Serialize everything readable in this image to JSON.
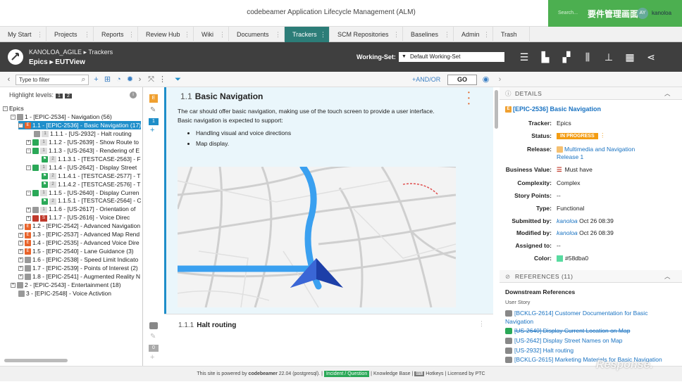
{
  "app": {
    "title": "codebeamer Application Lifecycle Management (ALM)",
    "jp_caption": "要件管理画面",
    "search_placeholder": "Search...",
    "avatar": "AY",
    "user": "kanoloa"
  },
  "nav": [
    "My Start",
    "Projects",
    "Reports",
    "Review Hub",
    "Wiki",
    "Documents",
    "Trackers",
    "SCM Repositories",
    "Baselines",
    "Admin",
    "Trash"
  ],
  "header": {
    "project": "KANOLOA_AGILE",
    "trackers": "Trackers",
    "tracker": "Epics",
    "view": "EUTView",
    "ws_label": "Working-Set:",
    "ws_value": "Default Working-Set"
  },
  "toolbar": {
    "filter_placeholder": "Type to filter",
    "andor": "AND/OR",
    "go": "GO"
  },
  "tree": {
    "highlight": "Highlight levels:",
    "lvl1": "1",
    "lvl2": "2",
    "nodes": [
      {
        "text": "Epics",
        "d": 0,
        "exp": "−",
        "ic": "none"
      },
      {
        "text": "1 - [EPIC-2534] - Navigation (56)",
        "d": 1,
        "exp": "−",
        "ic": "g"
      },
      {
        "text": "1.1 - [EPIC-2536] - Basic Navigation (17)",
        "d": 2,
        "exp": "−",
        "ic": "o",
        "sel": true
      },
      {
        "text": "1.1.1 - [US-2932] - Halt routing",
        "d": 3,
        "exp": "",
        "ic": "g",
        "lv": "1"
      },
      {
        "text": "1.1.2 - [US-2639] - Show Route to",
        "d": 3,
        "exp": "+",
        "ic": "c",
        "lv": "1"
      },
      {
        "text": "1.1.3 - [US-2643] - Rendering of E",
        "d": 3,
        "exp": "−",
        "ic": "c",
        "lv": "1"
      },
      {
        "text": "1.1.3.1 - [TESTCASE-2563] - F",
        "d": 4,
        "exp": "",
        "ic": "t",
        "lv": "2"
      },
      {
        "text": "1.1.4 - [US-2642] - Display Street",
        "d": 3,
        "exp": "−",
        "ic": "c",
        "lv": "1"
      },
      {
        "text": "1.1.4.1 - [TESTCASE-2577] - T",
        "d": 4,
        "exp": "",
        "ic": "t",
        "lv": "2"
      },
      {
        "text": "1.1.4.2 - [TESTCASE-2576] - T",
        "d": 4,
        "exp": "",
        "ic": "t",
        "lv": "2"
      },
      {
        "text": "1.1.5 - [US-2640] - Display Curren",
        "d": 3,
        "exp": "−",
        "ic": "c",
        "lv": "1"
      },
      {
        "text": "1.1.5.1 - [TESTCASE-2564] - C",
        "d": 4,
        "exp": "",
        "ic": "t",
        "lv": "2"
      },
      {
        "text": "1.1.6 - [US-2617] - Orientation of",
        "d": 3,
        "exp": "+",
        "ic": "g",
        "lv": "1"
      },
      {
        "text": "1.1.7 - [US-2616] - Voice Direc",
        "d": 3,
        "exp": "+",
        "ic": "r",
        "lv": "S"
      },
      {
        "text": "1.2 - [EPIC-2542] - Advanced Navigation",
        "d": 2,
        "exp": "+",
        "ic": "o"
      },
      {
        "text": "1.3 - [EPIC-2537] - Advanced Map Rend",
        "d": 2,
        "exp": "+",
        "ic": "o"
      },
      {
        "text": "1.4 - [EPIC-2535] - Advanced Voice Dire",
        "d": 2,
        "exp": "+",
        "ic": "o"
      },
      {
        "text": "1.5 - [EPIC-2540] - Lane Guidance (3)",
        "d": 2,
        "exp": "+",
        "ic": "o"
      },
      {
        "text": "1.6 - [EPIC-2538] - Speed Limit Indicato",
        "d": 2,
        "exp": "+",
        "ic": "g"
      },
      {
        "text": "1.7 - [EPIC-2539] - Points of Interest (2)",
        "d": 2,
        "exp": "+",
        "ic": "g"
      },
      {
        "text": "1.8 - [EPIC-2541] - Augmented Reality N",
        "d": 2,
        "exp": "+",
        "ic": "g"
      },
      {
        "text": "2 - [EPIC-2543] - Entertainment (18)",
        "d": 1,
        "exp": "+",
        "ic": "g"
      },
      {
        "text": "3 - [EPIC-2548] - Voice Activtion",
        "d": 1,
        "exp": "",
        "ic": "g"
      }
    ]
  },
  "doc": {
    "num": "1.1",
    "title": "Basic Navigation",
    "desc1": "The car should offer basic navigation, making use of the touch screen to provide a user interface.",
    "desc2": "Basic navigation is expected to support:",
    "bullets": [
      "Handling visual and voice directions",
      "Map display."
    ],
    "sub_num": "1.1.1",
    "sub_title": "Halt routing",
    "gut_num1": "1",
    "gut_num2": "0"
  },
  "details": {
    "head": "DETAILS",
    "item": "[EPIC-2536] Basic Navigation",
    "rows": [
      {
        "k": "Tracker:",
        "v": "Epics"
      },
      {
        "k": "Status:",
        "v": "IN PROGRESS"
      },
      {
        "k": "Release:",
        "v": "Multimedia and Navigation Release 1"
      },
      {
        "k": "Business Value:",
        "v": "Must have"
      },
      {
        "k": "Complexity:",
        "v": "Complex"
      },
      {
        "k": "Story Points:",
        "v": "--"
      },
      {
        "k": "Type:",
        "v": "Functional"
      },
      {
        "k": "Submitted by:",
        "v": "kanoloa",
        "d": "Oct 26 08:39"
      },
      {
        "k": "Modified by:",
        "v": "kanoloa",
        "d": "Oct 26 08:39"
      },
      {
        "k": "Assigned to:",
        "v": "--"
      },
      {
        "k": "Color:",
        "v": "#58dba0"
      }
    ]
  },
  "references": {
    "head": "REFERENCES (11)",
    "downstream": "Downstream References",
    "type": "User Story",
    "items": [
      "[BCKLG-2614] Customer Documentation for Basic Navigation",
      "[US-2640] Display Current Location on Map",
      "[US-2642] Display Street Names on Map",
      "[US-2932] Halt routing",
      "[BCKLG-2615] Marketing Materials for Basic Navigation"
    ]
  },
  "footer": {
    "pre": "This site is powered by",
    "brand": "codebeamer",
    "ver": "22.04 (postgresql).",
    "incident": "Incident / Question",
    "kb": "Knowledge Base",
    "hotkeys": "Hotkeys",
    "lic": "Licensed by PTC"
  },
  "watermark": "Response."
}
